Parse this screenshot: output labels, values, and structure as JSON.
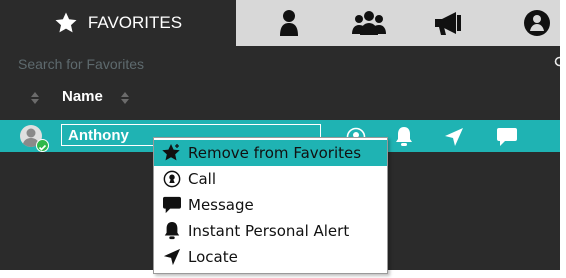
{
  "tabs": [
    {
      "label": "FAVORITES",
      "icon": "star-icon",
      "active": true
    },
    {
      "label": "",
      "icon": "person-icon",
      "active": false
    },
    {
      "label": "",
      "icon": "group-icon",
      "active": false
    },
    {
      "label": "",
      "icon": "megaphone-icon",
      "active": false
    },
    {
      "label": "",
      "icon": "globe-person-icon",
      "active": false
    }
  ],
  "search": {
    "placeholder": "Search for Favorites",
    "value": ""
  },
  "list_header": {
    "name": "Name"
  },
  "contact": {
    "name": "Anthony",
    "status": "online"
  },
  "row_actions": [
    "call-icon",
    "alert-bell-icon",
    "locate-arrow-icon",
    "message-icon"
  ],
  "context_menu": {
    "items": [
      {
        "label": "Remove from Favorites",
        "icon": "remove-favorite-icon",
        "highlighted": true
      },
      {
        "label": "Call",
        "icon": "call-icon"
      },
      {
        "label": "Message",
        "icon": "message-icon"
      },
      {
        "label": "Instant Personal Alert",
        "icon": "alert-bell-icon"
      },
      {
        "label": "Locate",
        "icon": "locate-arrow-icon"
      }
    ]
  },
  "colors": {
    "accent": "#1fb3b3",
    "panel": "#2b2b2b",
    "tabbar": "#d8d8d8",
    "online": "#2fb84a"
  }
}
